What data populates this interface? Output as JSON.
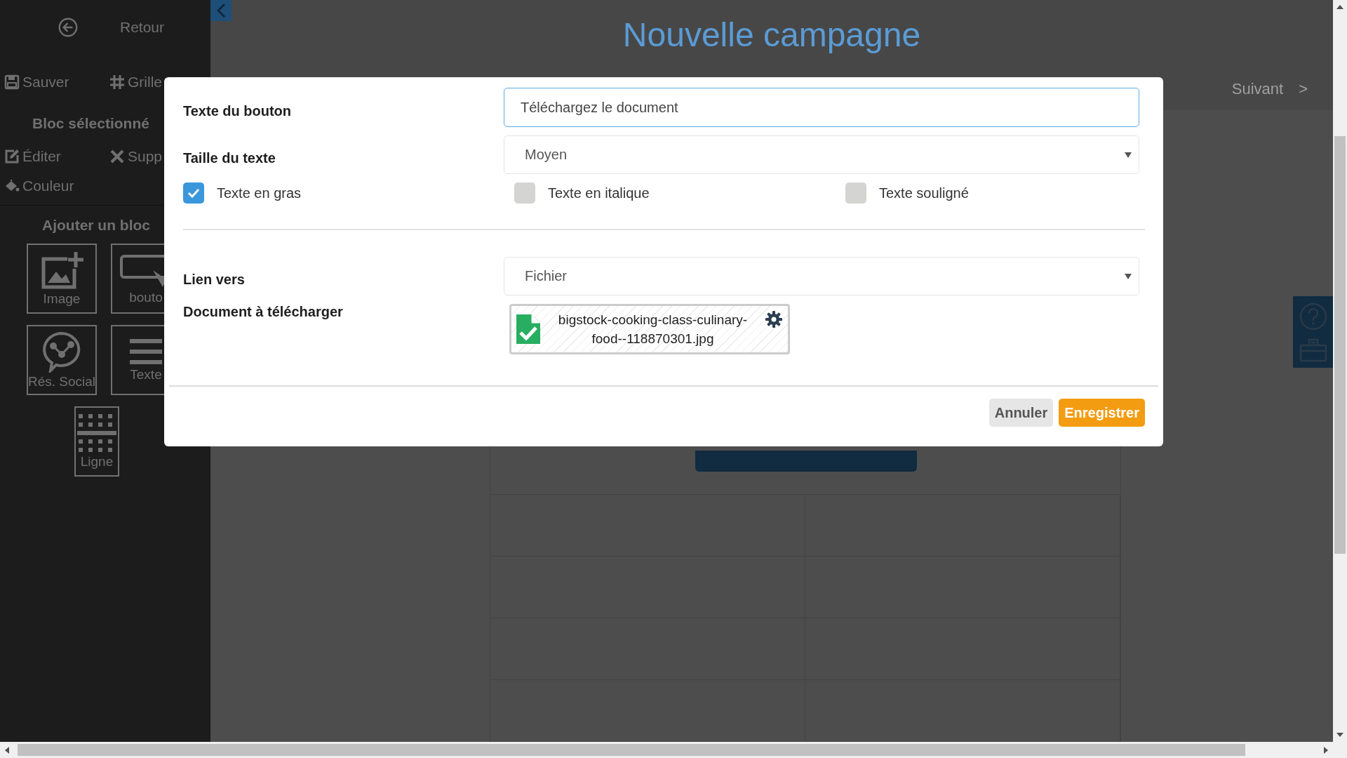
{
  "sidebar": {
    "back": {
      "label": "Retour"
    },
    "actions": [
      {
        "kind": "save",
        "label": "Sauver"
      },
      {
        "kind": "grid",
        "label": "Grille"
      }
    ],
    "selected_block": {
      "title": "Bloc sélectionné",
      "actions": [
        {
          "kind": "edit",
          "label": "Éditer"
        },
        {
          "kind": "delete",
          "label": "Supp"
        },
        {
          "kind": "color",
          "label": "Couleur"
        }
      ]
    },
    "add_block": {
      "title": "Ajouter un bloc",
      "tiles": [
        {
          "kind": "image",
          "label": "Image"
        },
        {
          "kind": "button",
          "label": "bouto"
        },
        {
          "kind": "social",
          "label": "Rés. Social"
        },
        {
          "kind": "text",
          "label": "Texte"
        },
        {
          "kind": "line",
          "label": "Ligne"
        }
      ]
    }
  },
  "header": {
    "title": "Nouvelle campagne",
    "next": {
      "label": "Suivant",
      "arrow": ">"
    }
  },
  "modal": {
    "fields": [
      {
        "kind": "text",
        "label": "Texte du bouton",
        "value": "Téléchargez le document",
        "focused": true
      },
      {
        "kind": "select",
        "label": "Taille du texte",
        "value": "Moyen"
      }
    ],
    "checkboxes": [
      {
        "label": "Texte en gras",
        "checked": true
      },
      {
        "label": "Texte en italique",
        "checked": false
      },
      {
        "label": "Texte souligné",
        "checked": false
      }
    ],
    "link_fields": [
      {
        "kind": "select",
        "label": "Lien vers",
        "value": "Fichier"
      }
    ],
    "document": {
      "label": "Document à télécharger",
      "file_name": "bigstock-cooking-class-culinary-food--118870301.jpg"
    },
    "buttons": [
      {
        "kind": "cancel",
        "label": "Annuler"
      },
      {
        "kind": "primary",
        "label": "Enregistrer"
      }
    ]
  }
}
